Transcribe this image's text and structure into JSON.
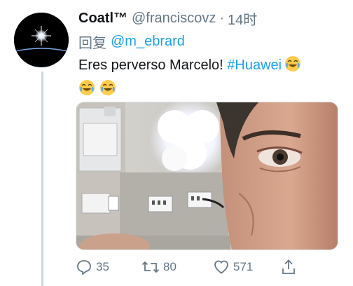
{
  "tweet": {
    "author": {
      "display_name": "Coatl™",
      "handle": "@franciscovz",
      "separator": "·",
      "timestamp": "14时"
    },
    "reply": {
      "prefix": "回复",
      "to": "@m_ebrard"
    },
    "text": {
      "before": "Eres perverso Marcelo! ",
      "hashtag": "#Huawei"
    },
    "emoji": "face-with-tears-of-joy",
    "media": {
      "kind": "photo",
      "description_icon": "photo-selfie"
    }
  },
  "actions": {
    "reply": {
      "icon": "reply-icon",
      "count": "35"
    },
    "retweet": {
      "icon": "retweet-icon",
      "count": "80"
    },
    "like": {
      "icon": "heart-icon",
      "count": "571"
    },
    "share": {
      "icon": "share-icon"
    }
  },
  "colors": {
    "link": "#1da1f2",
    "muted": "#657786",
    "text": "#14171a",
    "thread_line": "#ccd6dd"
  }
}
